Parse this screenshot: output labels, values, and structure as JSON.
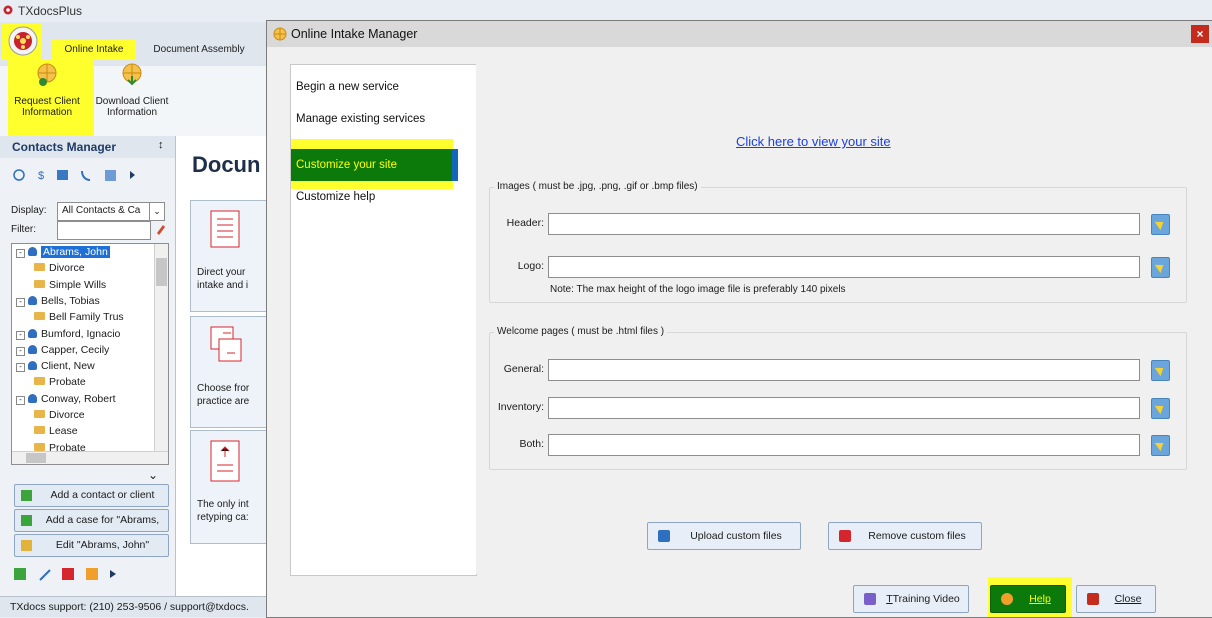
{
  "app": {
    "title": "TXdocsPlus",
    "ribbon_tabs": [
      "Online Intake",
      "Document Assembly"
    ],
    "ribbon_buttons": [
      {
        "label_line1": "Request Client",
        "label_line2": "Information"
      },
      {
        "label_line1": "Download Client",
        "label_line2": "Information"
      }
    ]
  },
  "contacts_manager": {
    "title": "Contacts Manager",
    "pin": "↕",
    "display_label": "Display:",
    "display_value": "All Contacts & Ca",
    "filter_label": "Filter:",
    "filter_value": "",
    "tree": [
      {
        "label": "Abrams, John",
        "type": "person",
        "level": 0,
        "selected": true
      },
      {
        "label": "Divorce",
        "type": "case",
        "level": 1
      },
      {
        "label": "Simple Wills",
        "type": "case",
        "level": 1
      },
      {
        "label": "Bells, Tobias",
        "type": "person",
        "level": 0
      },
      {
        "label": "Bell Family Trus",
        "type": "case",
        "level": 1
      },
      {
        "label": "Bumford, Ignacio",
        "type": "person",
        "level": 0
      },
      {
        "label": "Capper, Cecily",
        "type": "person",
        "level": 0
      },
      {
        "label": "Client, New",
        "type": "person",
        "level": 0
      },
      {
        "label": "Probate",
        "type": "case",
        "level": 1
      },
      {
        "label": "Conway, Robert",
        "type": "person",
        "level": 0
      },
      {
        "label": "Divorce",
        "type": "case",
        "level": 1
      },
      {
        "label": "Lease",
        "type": "case",
        "level": 1
      },
      {
        "label": "Probate",
        "type": "case",
        "level": 1
      }
    ],
    "buttons": {
      "add_contact": "Add a contact or client",
      "add_case": "Add a case for \"Abrams,",
      "edit": "Edit \"Abrams, John\""
    }
  },
  "documents": {
    "heading": "Docun",
    "cards": [
      {
        "line1": "Direct your",
        "line2": "intake and i"
      },
      {
        "line1": "Choose fror",
        "line2": "practice are"
      },
      {
        "line1": "The only int",
        "line2": "retyping ca:"
      }
    ]
  },
  "status_bar": {
    "text": "TXdocs support: (210) 253-9506 / support@txdocs."
  },
  "dialog": {
    "title": "Online Intake Manager",
    "close_glyph": "×",
    "nav": [
      {
        "label": "Begin a new service"
      },
      {
        "label": "Manage existing services"
      },
      {
        "label": "Customize your site",
        "active": true
      },
      {
        "label": "Customize help"
      }
    ],
    "view_site_link": "Click here to view your site",
    "images_group": {
      "title": "Images ( must be .jpg, .png, .gif or .bmp files)",
      "header_label": "Header:",
      "header_value": "",
      "logo_label": "Logo:",
      "logo_value": "",
      "note": "Note: The max height of the logo image file is preferably 140 pixels"
    },
    "welcome_group": {
      "title": "Welcome pages ( must be .html files )",
      "general_label": "General:",
      "general_value": "",
      "inventory_label": "Inventory:",
      "inventory_value": "",
      "both_label": "Both:",
      "both_value": ""
    },
    "buttons": {
      "upload": "Upload custom files",
      "remove": "Remove custom files",
      "training_video": "Training Video",
      "help": "Help",
      "close": "Close"
    }
  },
  "colors": {
    "highlight": "#ffff2e",
    "nav_active_bg": "#0b7a0b",
    "nav_active_text": "#ffff00",
    "link": "#1a3fe0",
    "close_button": "#c42b1c"
  }
}
